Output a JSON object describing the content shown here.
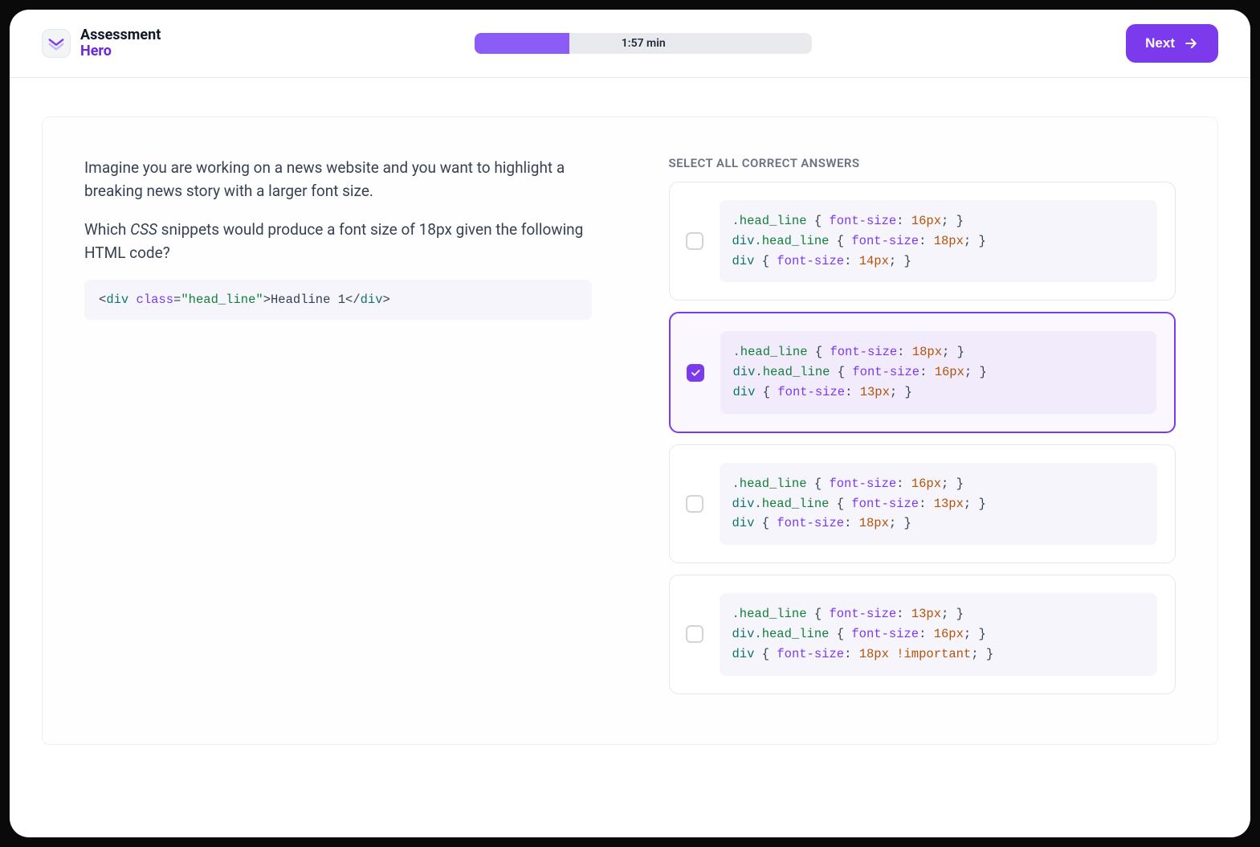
{
  "brand": {
    "line1": "Assessment",
    "line2": "Hero"
  },
  "progress": {
    "percent": 28,
    "label": "1:57 min"
  },
  "next_label": "Next",
  "question": {
    "para1_a": "Imagine you are working on a news website and you want to highlight a breaking news story with a larger font size.",
    "para2_a": "Which ",
    "para2_em": "CSS",
    "para2_b": " snippets would produce a font size of 18px given the following HTML code?",
    "snippet": {
      "tag": "div",
      "attr": "class",
      "val": "\"head_line\"",
      "text": "Headline 1"
    }
  },
  "instruction": "SELECT ALL CORRECT ANSWERS",
  "answers": [
    {
      "checked": false,
      "lines": [
        {
          "sel_pre": "",
          "sel_class": ".head_line",
          "prop": "font-size",
          "val": "16px",
          "extra": ""
        },
        {
          "sel_pre": "div",
          "sel_class": ".head_line",
          "prop": "font-size",
          "val": "18px",
          "extra": ""
        },
        {
          "sel_pre": "div",
          "sel_class": "",
          "prop": "font-size",
          "val": "14px",
          "extra": ""
        }
      ]
    },
    {
      "checked": true,
      "lines": [
        {
          "sel_pre": "",
          "sel_class": ".head_line",
          "prop": "font-size",
          "val": "18px",
          "extra": ""
        },
        {
          "sel_pre": "div",
          "sel_class": ".head_line",
          "prop": "font-size",
          "val": "16px",
          "extra": ""
        },
        {
          "sel_pre": "div",
          "sel_class": "",
          "prop": "font-size",
          "val": "13px",
          "extra": ""
        }
      ]
    },
    {
      "checked": false,
      "lines": [
        {
          "sel_pre": "",
          "sel_class": ".head_line",
          "prop": "font-size",
          "val": "16px",
          "extra": ""
        },
        {
          "sel_pre": "div",
          "sel_class": ".head_line",
          "prop": "font-size",
          "val": "13px",
          "extra": ""
        },
        {
          "sel_pre": "div",
          "sel_class": "",
          "prop": "font-size",
          "val": "18px",
          "extra": ""
        }
      ]
    },
    {
      "checked": false,
      "lines": [
        {
          "sel_pre": "",
          "sel_class": ".head_line",
          "prop": "font-size",
          "val": "13px",
          "extra": ""
        },
        {
          "sel_pre": "div",
          "sel_class": ".head_line",
          "prop": "font-size",
          "val": "16px",
          "extra": ""
        },
        {
          "sel_pre": "div",
          "sel_class": "",
          "prop": "font-size",
          "val": "18px",
          "extra": " !important"
        }
      ]
    }
  ]
}
